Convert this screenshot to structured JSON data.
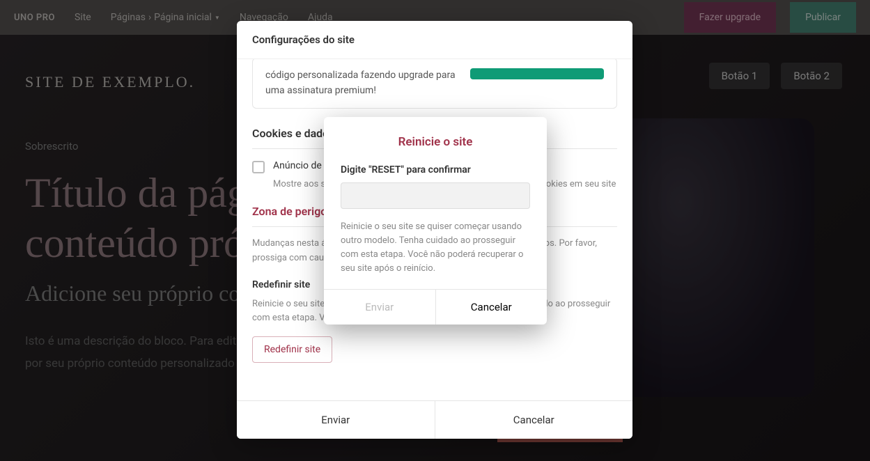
{
  "toolbar": {
    "logo": "UNO PRO",
    "menu": {
      "site": "Site",
      "paginas": "Páginas",
      "page_current": "Página inicial",
      "navegacao": "Navegação",
      "ajuda": "Ajuda"
    },
    "upgrade": "Fazer upgrade",
    "publish": "Publicar"
  },
  "page": {
    "site_logo": "SITE DE EXEMPLO.",
    "sobrescrito": "Sobrescrito",
    "hero_title": "Título da página. Substitua-o com conteúdo próprio",
    "hero_subtitle": "Adicione seu próprio conteúdo de bloco",
    "hero_desc": "Isto é uma descrição do bloco. Para editar, clique e digite o texto ou substitua-o por seu próprio conteúdo personalizado e converter visitantes do site em clientes.",
    "btn1": "Botão 1",
    "btn2": "Botão 2"
  },
  "settings": {
    "title": "Configurações do site",
    "promo_text": "código personalizada fazendo upgrade para uma assinatura premium!",
    "cookies_title": "Cookies e dados",
    "cookies_checkbox_label": "Anúncio de cookies",
    "cookies_checkbox_desc": "Mostre aos seus visitantes uma mensagem sobre a utilização de cookies em seu site",
    "danger_title": "Zona de perigo",
    "danger_desc": "Mudanças nesta área podem resultar em remoções permanentes de dados. Por favor, prossiga com cautela.",
    "reset_subtitle": "Redefinir site",
    "reset_desc": "Reinicie o seu site se quiser começar usando outro modelo. Tenha cuidado ao prosseguir com esta etapa. Você não poderá recuperar o seu site após o reinício.",
    "reset_btn": "Redefinir site",
    "footer_submit": "Enviar",
    "footer_cancel": "Cancelar"
  },
  "confirm": {
    "title": "Reinicie o site",
    "label": "Digite \"RESET\" para confirmar",
    "input_value": "",
    "desc": "Reinicie o seu site se quiser começar usando outro modelo. Tenha cuidado ao prosseguir com esta etapa. Você não poderá recuperar o seu site após o reinício.",
    "submit": "Enviar",
    "cancel": "Cancelar"
  }
}
